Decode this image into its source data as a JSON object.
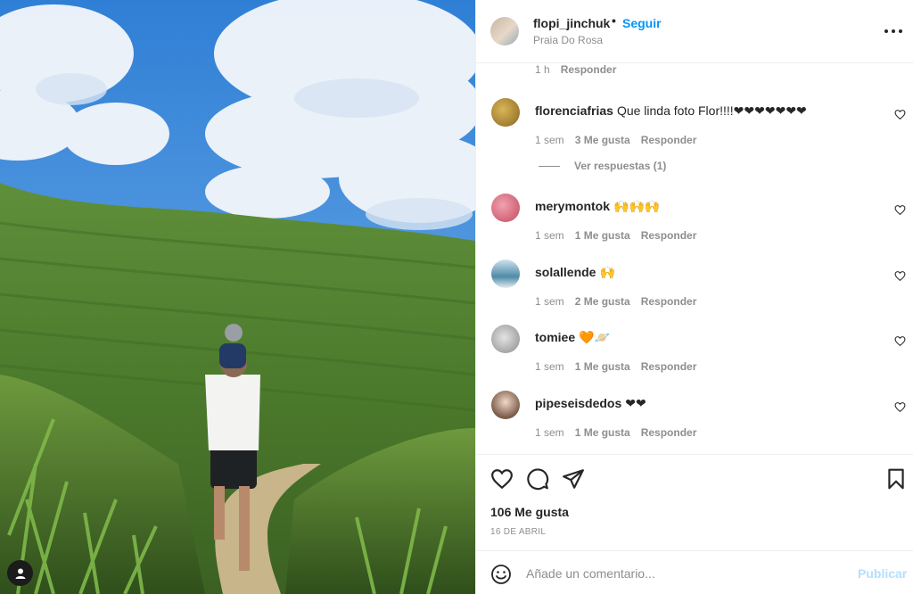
{
  "header": {
    "username": "flopi_jinchuk",
    "separator": "•",
    "follow_label": "Seguir",
    "location": "Praia Do Rosa"
  },
  "caption_meta": {
    "time": "1 h",
    "reply_label": "Responder"
  },
  "comments": [
    {
      "username": "florenciafrias",
      "text": "Que linda foto Flor!!!!❤❤❤❤❤❤❤",
      "time": "1 sem",
      "likes": "3 Me gusta",
      "reply_label": "Responder",
      "avatar_color": "#b08a3a"
    },
    {
      "username": "merymontok",
      "text": "🙌🙌🙌",
      "time": "1 sem",
      "likes": "1 Me gusta",
      "reply_label": "Responder",
      "avatar_color": "#d65a6e"
    },
    {
      "username": "solallende",
      "text": "🙌",
      "time": "1 sem",
      "likes": "2 Me gusta",
      "reply_label": "Responder",
      "avatar_color": "#5e8fa8"
    },
    {
      "username": "tomiee",
      "text": "🧡🪐",
      "time": "1 sem",
      "likes": "1 Me gusta",
      "reply_label": "Responder",
      "avatar_color": "#9c9c9c"
    },
    {
      "username": "pipeseisdedos",
      "text": "❤❤",
      "time": "1 sem",
      "likes": "1 Me gusta",
      "reply_label": "Responder",
      "avatar_color": "#7a5a48"
    }
  ],
  "view_replies": "Ver respuestas (1)",
  "actions": {
    "likes_count": "106 Me gusta",
    "date": "16 DE ABRIL"
  },
  "add_comment": {
    "placeholder": "Añade un comentario...",
    "publish_label": "Publicar"
  },
  "colors": {
    "accent": "#0095f6",
    "publish_disabled": "#b2dffc",
    "muted": "#8e8e8e",
    "heart": "#ed4956"
  }
}
